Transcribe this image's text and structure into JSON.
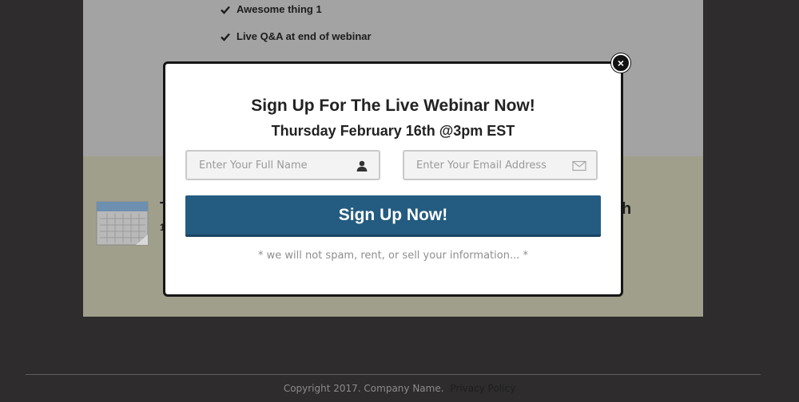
{
  "background_page": {
    "bullets": [
      "Awesome thing 1",
      "Live Q&A at end of webinar"
    ],
    "partial_letter_left": "T",
    "partial_letter_left_small": "1",
    "partial_letter_right": "h"
  },
  "modal": {
    "title": "Sign Up For The Live Webinar Now!",
    "subtitle": "Thursday February 16th @3pm EST",
    "name_field": {
      "placeholder": "Enter Your Full Name",
      "value": "",
      "icon": "user-icon"
    },
    "email_field": {
      "placeholder": "Enter Your Email Address",
      "value": "",
      "icon": "envelope-icon"
    },
    "submit_label": "Sign Up Now!",
    "disclaimer": "* we will not spam, rent, or sell your information... *",
    "close_label": "×",
    "colors": {
      "button": "#245b80",
      "overlay": "#2e2c2c"
    }
  },
  "footer": {
    "copyright": "Copyright 2017. Company Name.",
    "privacy_link": "Privacy Policy"
  }
}
